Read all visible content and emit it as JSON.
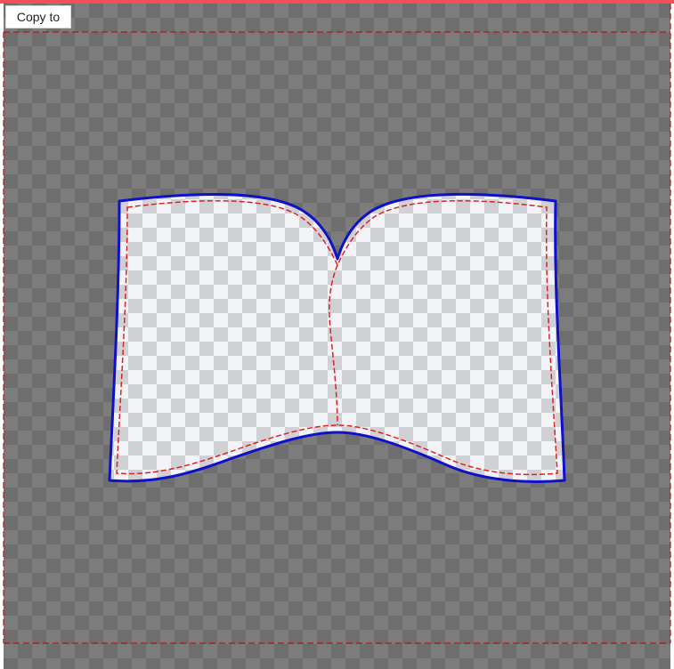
{
  "toolbar": {
    "copy_to_label": "Copy to"
  },
  "colors": {
    "top_accent": "#f0505a",
    "outline": "#1010c8",
    "seam_dashes": "#e02020",
    "margin_dashes": "#b01818",
    "shape_fill_light": "#f2f3f7",
    "shape_fill_dark": "#d0d1d5",
    "canvas_dark": "#6e6e6e",
    "canvas_light": "#7c7c7c"
  },
  "canvas": {
    "shape": "book-shaped cutout with transparency checkerboard",
    "background": "transparency-checkerboard"
  }
}
